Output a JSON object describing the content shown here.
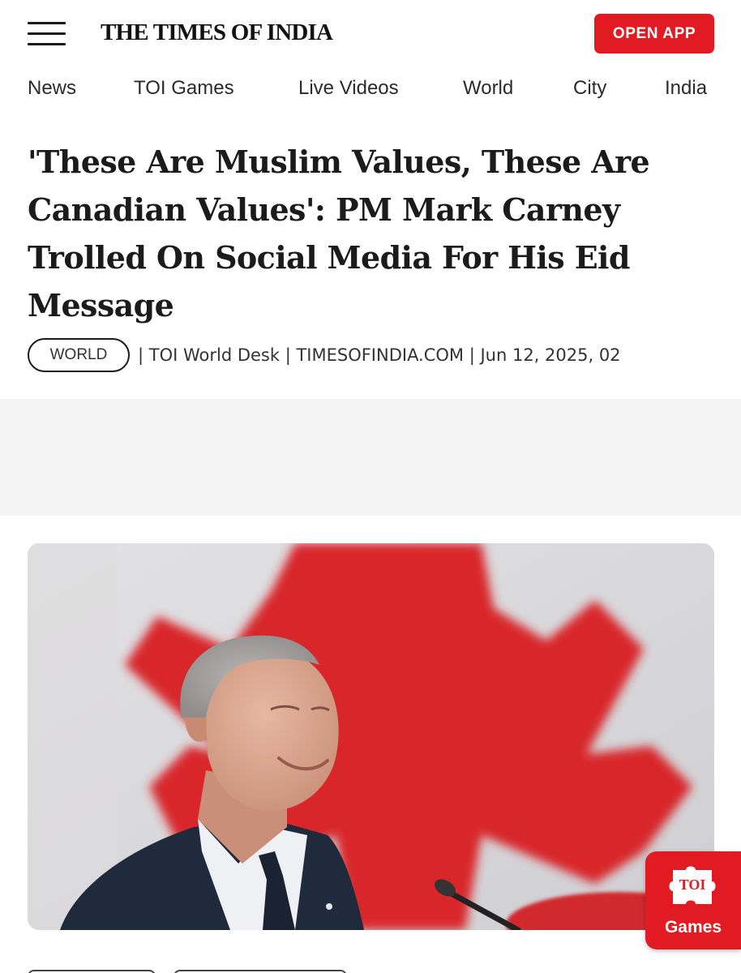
{
  "header": {
    "logo_text": "THE TIMES OF INDIA",
    "open_app_label": "OPEN APP",
    "menu_icon": "hamburger-menu-icon"
  },
  "nav": {
    "items": [
      {
        "label": "News"
      },
      {
        "label": "TOI Games"
      },
      {
        "label": "Live Videos"
      },
      {
        "label": "World"
      },
      {
        "label": "City"
      },
      {
        "label": "India"
      }
    ]
  },
  "article": {
    "headline": "'These Are Muslim Values, These Are Canadian Values': PM Mark Carney Trolled On Social Media For His Eid Message",
    "category": "WORLD",
    "byline": "| TOI World Desk | TIMESOFINDIA.COM | Jun 12, 2025, 02"
  },
  "games_fab": {
    "icon_text": "TOI",
    "label": "Games",
    "icon": "puzzle-piece-icon"
  },
  "colors": {
    "brand_red": "#e21b22",
    "text": "#1a1a1a",
    "ad_background": "#f4f4f4"
  }
}
